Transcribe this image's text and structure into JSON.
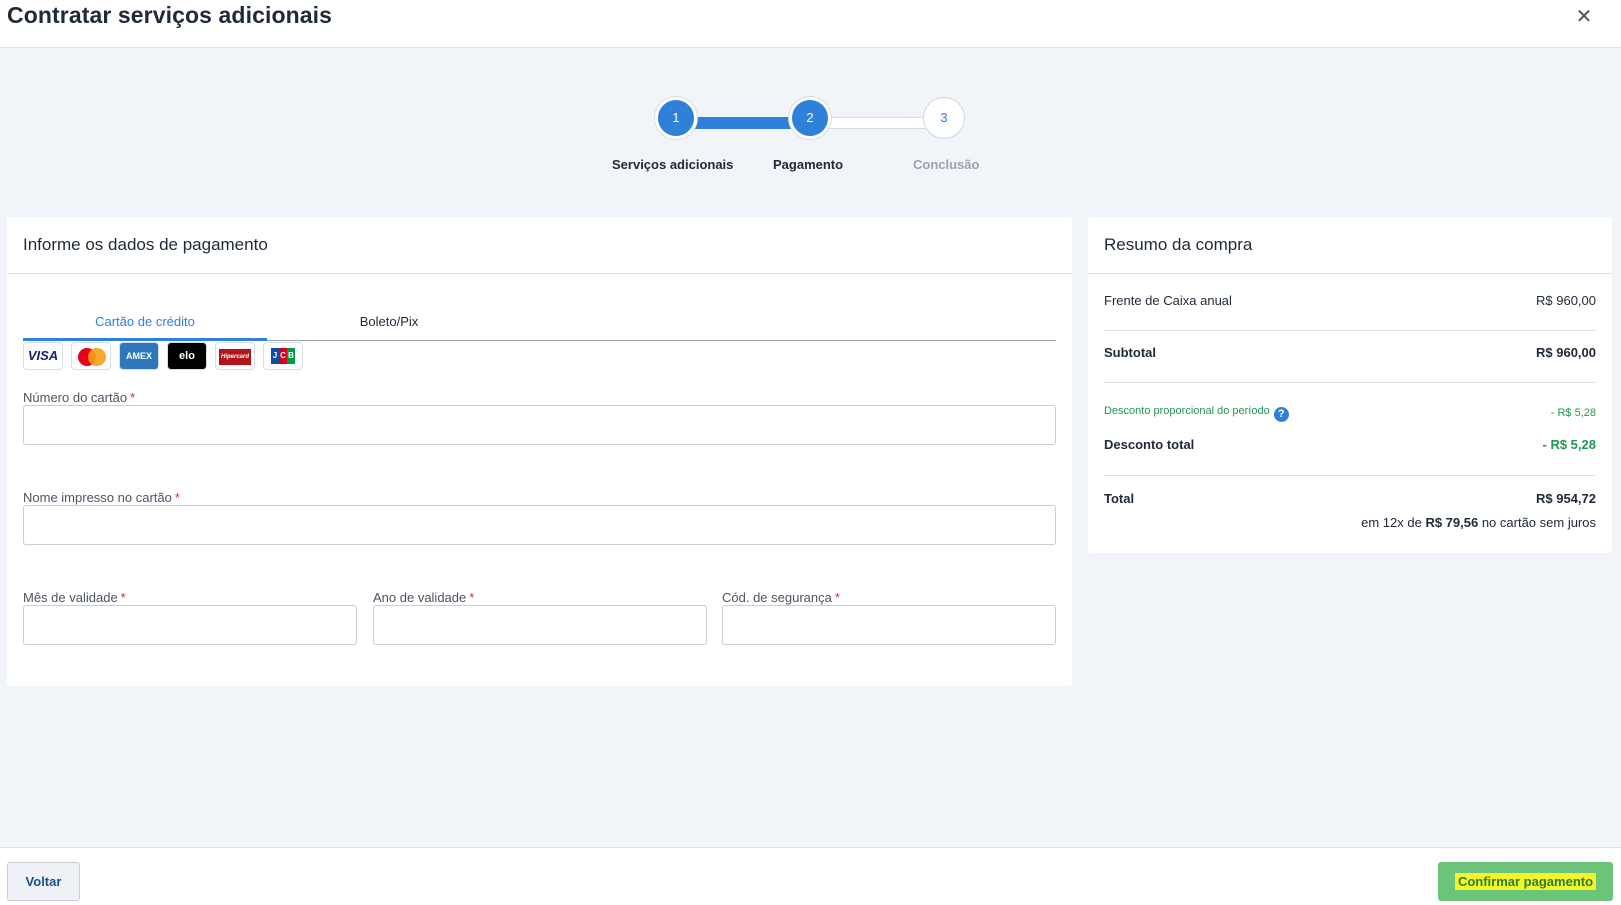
{
  "header": {
    "title": "Contratar serviços adicionais",
    "close_icon": "close-icon"
  },
  "stepper": {
    "steps": [
      {
        "number": "1",
        "label": "Serviços adicionais",
        "state": "done"
      },
      {
        "number": "2",
        "label": "Pagamento",
        "state": "active"
      },
      {
        "number": "3",
        "label": "Conclusão",
        "state": "pending"
      }
    ],
    "accent": "#2f80d9"
  },
  "payment": {
    "title": "Informe os dados de pagamento",
    "tabs": [
      {
        "label": "Cartão de crédito",
        "active": true
      },
      {
        "label": "Boleto/Pix",
        "active": false
      }
    ],
    "brands": {
      "visa": "VISA",
      "mastercard": "mastercard-logo",
      "amex": "AMEX",
      "elo": "elo",
      "hipercard": "Hipercard",
      "jcb": [
        "J",
        "C",
        "B"
      ]
    },
    "fields": {
      "card_number": {
        "label": "Número do cartão",
        "value": ""
      },
      "card_name": {
        "label": "Nome impresso no cartão",
        "value": ""
      },
      "exp_month": {
        "label": "Mês de validade",
        "value": ""
      },
      "exp_year": {
        "label": "Ano de validade",
        "value": ""
      },
      "cvv": {
        "label": "Cód. de segurança",
        "value": ""
      }
    },
    "required_mark": "*"
  },
  "summary": {
    "title": "Resumo da compra",
    "item": {
      "label": "Frente de Caixa anual",
      "value": "R$ 960,00"
    },
    "subtotal": {
      "label": "Subtotal",
      "value": "R$ 960,00"
    },
    "discount_prop": {
      "label": "Desconto proporcional do período",
      "value": "- R$ 5,28",
      "help_icon": "question-icon"
    },
    "discount_total": {
      "label": "Desconto total",
      "value": "- R$ 5,28"
    },
    "total": {
      "label": "Total",
      "value": "R$ 954,72"
    },
    "installments": {
      "prefix": "em 12x de",
      "amount": "R$ 79,56",
      "suffix": "no cartão sem juros"
    },
    "discount_color": "#219653"
  },
  "footer": {
    "back_label": "Voltar",
    "confirm_label": "Confirmar pagamento",
    "confirm_color": "#6cc47a"
  }
}
